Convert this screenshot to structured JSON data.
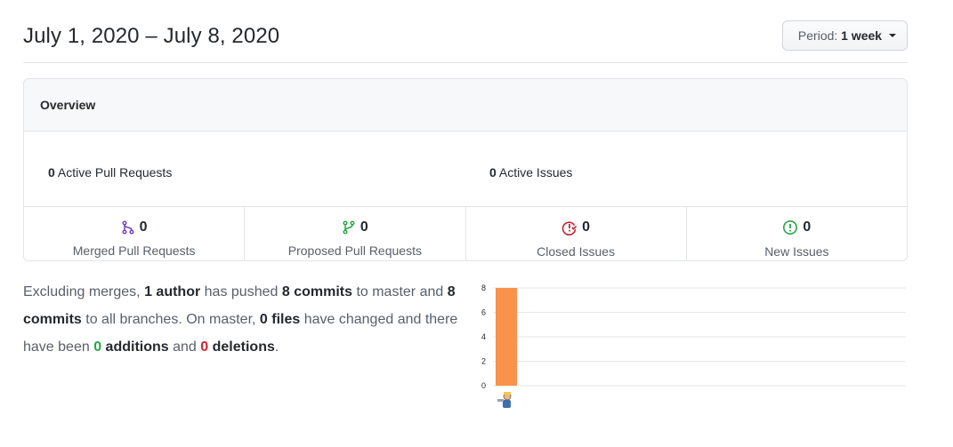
{
  "header": {
    "date_range": "July 1, 2020 – July 8, 2020",
    "period_label": "Period:",
    "period_value": "1 week"
  },
  "overview": {
    "title": "Overview",
    "active_pull_requests": {
      "count": "0",
      "label": "Active Pull Requests"
    },
    "active_issues": {
      "count": "0",
      "label": "Active Issues"
    },
    "summary": [
      {
        "count": "0",
        "label": "Merged Pull Requests",
        "icon": "git-merge-icon",
        "color": "#6f42c1"
      },
      {
        "count": "0",
        "label": "Proposed Pull Requests",
        "icon": "git-branch-icon",
        "color": "#28a745"
      },
      {
        "count": "0",
        "label": "Closed Issues",
        "icon": "issue-closed-icon",
        "color": "#cb2431"
      },
      {
        "count": "0",
        "label": "New Issues",
        "icon": "issue-opened-icon",
        "color": "#28a745"
      }
    ]
  },
  "commits": {
    "p1": "Excluding merges,",
    "authors": "1 author",
    "p2": "has pushed",
    "commits_master": "8 commits",
    "p3": "to master and",
    "commits_all": "8 commits",
    "p4": "to all branches. On master,",
    "files": "0 files",
    "p5": "have changed and there have been",
    "additions_num": "0",
    "additions_word": "additions",
    "p6": "and",
    "deletions_num": "0",
    "deletions_word": "deletions",
    "p7": "."
  },
  "chart_data": {
    "type": "bar",
    "categories": [
      "author"
    ],
    "values": [
      8
    ],
    "ylim": [
      0,
      8
    ],
    "yticks": [
      "0",
      "2",
      "4",
      "6",
      "8"
    ],
    "grid": true,
    "bar_color": "#f9924b",
    "xlabel": "",
    "ylabel": "",
    "title": ""
  }
}
